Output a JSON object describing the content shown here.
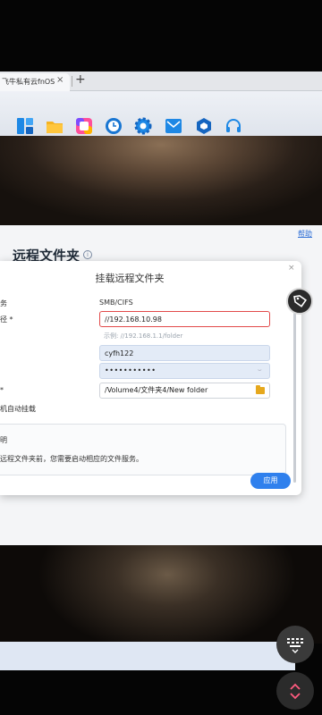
{
  "browser": {
    "tab_title": "飞牛私有云fnOS",
    "tab_close": "×",
    "new_tab": "+"
  },
  "appbar": {
    "icons": [
      "dashboard-icon",
      "folder-icon",
      "app-center-icon",
      "clock-icon",
      "settings-gear-icon",
      "mail-icon",
      "cube-icon",
      "headset-icon"
    ]
  },
  "window": {
    "help_link": "帮助",
    "title": "远程文件夹",
    "info_icon": "i"
  },
  "dialog": {
    "title": "挂载远程文件夹",
    "close": "×",
    "labels": {
      "protocol": "务",
      "address": "径 *",
      "path": "*",
      "automount": "机自动挂载",
      "note_head": "明"
    },
    "protocol_value": "SMB/CIFS",
    "address_value": "//192.168.10.98",
    "address_hint": "示例: //192.168.1.1/folder",
    "username_value": "cyfh122",
    "password_value": "•••••••••••",
    "password_eye": "⌣",
    "path_value": "/Volume4/文件夹4/New folder",
    "note_text": "远程文件夹前，您需要启动相应的文件服务。",
    "apply_label": "应用"
  },
  "colors": {
    "accent": "#2f80ed",
    "error_border": "#e24a4a",
    "folder": "#e6a81d"
  }
}
